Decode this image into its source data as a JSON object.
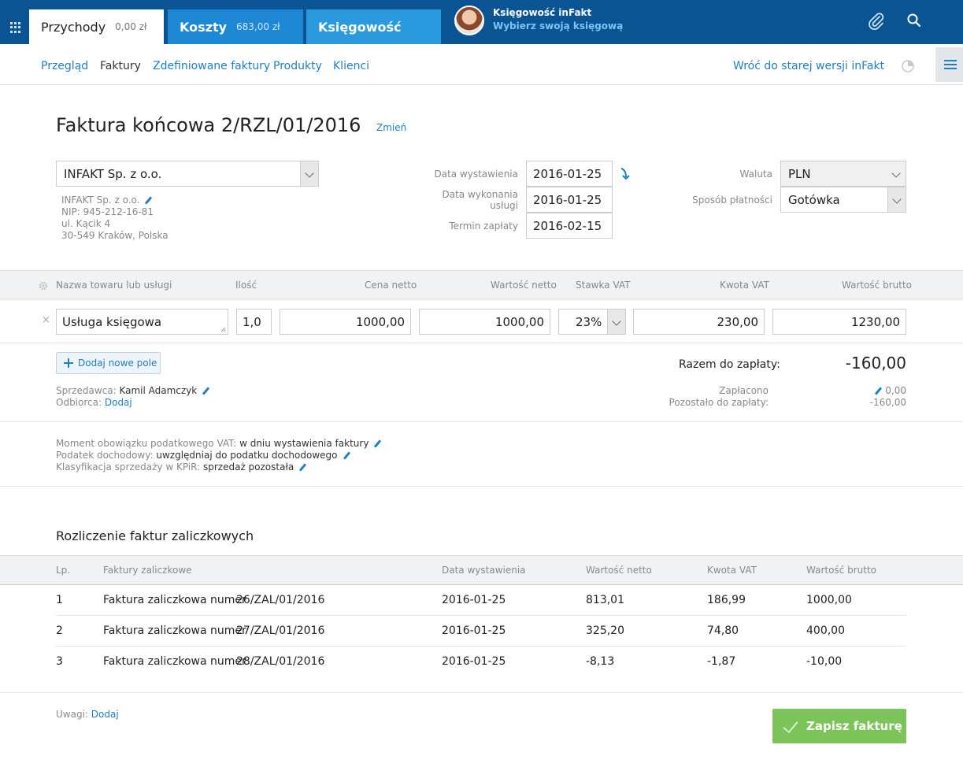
{
  "topbar": {
    "tabs": [
      {
        "label": "Przychody",
        "amount": "0,00 zł"
      },
      {
        "label": "Koszty",
        "amount": "683,00 zł"
      },
      {
        "label": "Księgowość",
        "amount": ""
      }
    ],
    "account_name": "Księgowość inFakt",
    "account_link": "Wybierz swoją księgową"
  },
  "subnav": {
    "items": [
      "Przegląd",
      "Faktury",
      "Zdefiniowane faktury",
      "Produkty",
      "Klienci"
    ],
    "old_version": "Wróć do starej wersji inFakt"
  },
  "invoice": {
    "title": "Faktura końcowa 2/RZL/01/2016",
    "change": "Zmień",
    "client_select": "INFAKT Sp. z o.o.",
    "client_lines": [
      "INFAKT Sp. z o.o.",
      "NIP: 945-212-16-81",
      "ul. Kącik 4",
      "30-549 Kraków, Polska"
    ],
    "labels": {
      "issue_date": "Data wystawienia",
      "service_date_1": "Data wykonania",
      "service_date_2": "usługi",
      "due_date": "Termin zapłaty",
      "currency": "Waluta",
      "payment": "Sposób płatności"
    },
    "issue_date": "2016-01-25",
    "service_date": "2016-01-25",
    "due_date": "2016-02-15",
    "currency": "PLN",
    "payment": "Gotówka"
  },
  "items": {
    "headers": [
      "Nazwa towaru lub usługi",
      "Ilość",
      "Cena netto",
      "Wartość netto",
      "Stawka VAT",
      "Kwota VAT",
      "Wartość brutto"
    ],
    "row": {
      "name": "Usługa księgowa",
      "qty": "1,0",
      "price": "1000,00",
      "net": "1000,00",
      "vat_rate": "23%",
      "vat": "230,00",
      "gross": "1230,00"
    },
    "remove": "×",
    "add_label": "Dodaj nowe pole"
  },
  "summary": {
    "total_label": "Razem do zapłaty:",
    "total_value": "-160,00",
    "paid_label": "Zapłacono",
    "paid_value": "0,00",
    "remaining_label": "Pozostało do zapłaty:",
    "remaining_value": "-160,00"
  },
  "parties": {
    "seller_label": "Sprzedawca:",
    "seller_value": "Kamil Adamczyk",
    "buyer_label": "Odbiorca:",
    "buyer_value": "Dodaj"
  },
  "tax": {
    "vat_moment_label": "Moment obowiązku podatkowego VAT:",
    "vat_moment_value": "w dniu wystawienia faktury",
    "income_tax_label": "Podatek dochodowy:",
    "income_tax_value": "uwzględniaj do podatku dochodowego",
    "kpir_label": "Klasyfikacja sprzedaży w KPiR:",
    "kpir_value": "sprzedaż pozostała"
  },
  "advances": {
    "title": "Rozliczenie faktur zaliczkowych",
    "headers": [
      "Lp.",
      "Faktury zaliczkowe",
      "Data wystawienia",
      "Wartość netto",
      "Kwota VAT",
      "Wartość brutto"
    ],
    "rows": [
      {
        "lp": "1",
        "text": "Faktura zaliczkowa numer",
        "num": "26/ZAL/01/2016",
        "date": "2016-01-25",
        "net": "813,01",
        "vat": "186,99",
        "gross": "1000,00"
      },
      {
        "lp": "2",
        "text": "Faktura zaliczkowa numer",
        "num": "27/ZAL/01/2016",
        "date": "2016-01-25",
        "net": "325,20",
        "vat": "74,80",
        "gross": "400,00"
      },
      {
        "lp": "3",
        "text": "Faktura zaliczkowa numer",
        "num": "28/ZAL/01/2016",
        "date": "2016-01-25",
        "net": "-8,13",
        "vat": "-1,87",
        "gross": "-10,00"
      }
    ]
  },
  "footer": {
    "notes_label": "Uwagi:",
    "notes_link": "Dodaj",
    "save_label": "Zapisz fakturę"
  },
  "colors": {
    "topbar": "#0a5494",
    "tab_blue": "#1e88d4",
    "tab_light": "#2a99de",
    "link": "#1f7fc4",
    "save": "#7cc35a"
  },
  "icons": [
    "apps-grid-icon",
    "avatar",
    "paperclip-icon",
    "search-icon",
    "pie-chart-icon",
    "hamburger-menu-icon",
    "pencil-icon",
    "gear-icon",
    "close-icon",
    "plus-icon",
    "check-icon",
    "chevron-down-icon",
    "swap-arrow-icon"
  ]
}
